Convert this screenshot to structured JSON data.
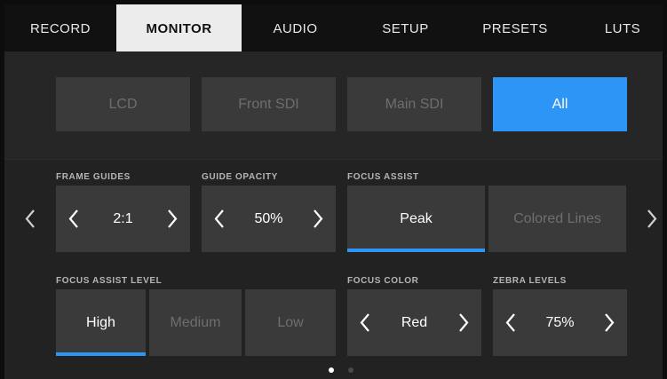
{
  "tabs": [
    {
      "label": "RECORD"
    },
    {
      "label": "MONITOR"
    },
    {
      "label": "AUDIO"
    },
    {
      "label": "SETUP"
    },
    {
      "label": "PRESETS"
    },
    {
      "label": "LUTS"
    }
  ],
  "active_tab": "MONITOR",
  "sources": [
    {
      "label": "LCD"
    },
    {
      "label": "Front SDI"
    },
    {
      "label": "Main SDI"
    },
    {
      "label": "All"
    }
  ],
  "active_source": "All",
  "frame_guides": {
    "label": "FRAME GUIDES",
    "value": "2:1"
  },
  "guide_opacity": {
    "label": "GUIDE OPACITY",
    "value": "50%"
  },
  "focus_assist": {
    "label": "FOCUS ASSIST",
    "options": [
      "Peak",
      "Colored Lines"
    ],
    "selected": "Peak"
  },
  "focus_assist_level": {
    "label": "FOCUS ASSIST LEVEL",
    "options": [
      "High",
      "Medium",
      "Low"
    ],
    "selected": "High"
  },
  "focus_color": {
    "label": "FOCUS COLOR",
    "value": "Red"
  },
  "zebra_levels": {
    "label": "ZEBRA LEVELS",
    "value": "75%"
  },
  "pagination": {
    "pages": 2,
    "current": 1
  },
  "colors": {
    "accent": "#2d95f5",
    "panel": "#3a3a3a",
    "background": "#262626"
  },
  "icons": {
    "left_arrow": "chevron-left-icon",
    "right_arrow": "chevron-right-icon"
  }
}
